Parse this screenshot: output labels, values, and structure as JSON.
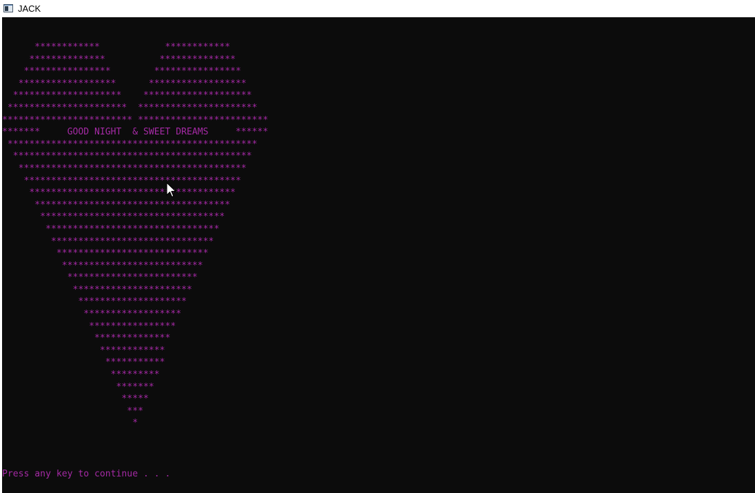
{
  "window": {
    "title": "JACK",
    "icon": "console-window-icon"
  },
  "console": {
    "colors": {
      "background": "#0c0c0c",
      "text": "#a52aa5"
    },
    "heart_lines": [
      "      ************            ************",
      "     **************          **************",
      "    ****************        ****************",
      "   ******************      ******************",
      "  ********************    ********************",
      " **********************  **********************",
      "************************ ************************",
      "*******     GOOD NIGHT  & SWEET DREAMS     ******",
      " **********************************************",
      "  ********************************************",
      "   ******************************************",
      "    ****************************************",
      "     **************************************",
      "      ************************************",
      "       **********************************",
      "        ********************************",
      "         ******************************",
      "          ****************************",
      "           **************************",
      "            ************************",
      "             **********************",
      "              ********************",
      "               ******************",
      "                ****************",
      "                 **************",
      "                  ************",
      "                   ***********",
      "                    *********",
      "                     *******",
      "                      *****",
      "                       ***",
      "                        *"
    ],
    "prompt": "Press any key to continue . . ."
  }
}
